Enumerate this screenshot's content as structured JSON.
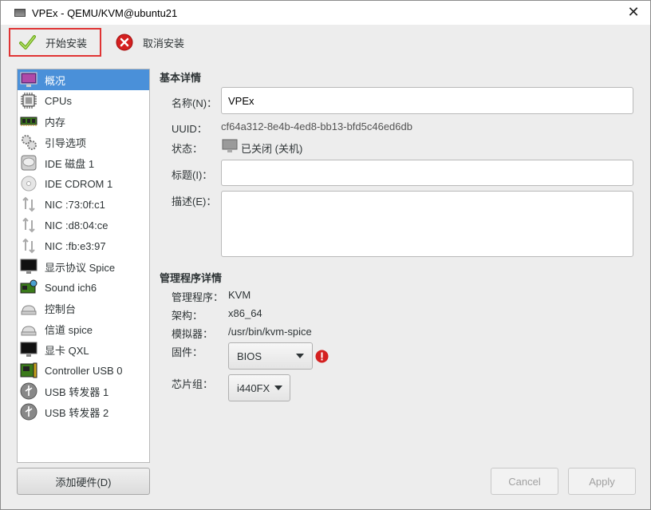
{
  "window": {
    "title": "VPEx - QEMU/KVM@ubuntu21",
    "close_glyph": "✕"
  },
  "toolbar": {
    "start_install": "开始安装",
    "cancel_install": "取消安装"
  },
  "sidebar": {
    "items": [
      {
        "label": "概况",
        "icon": "monitor-overview-icon"
      },
      {
        "label": "CPUs",
        "icon": "cpu-chip-icon"
      },
      {
        "label": "内存",
        "icon": "memory-module-icon"
      },
      {
        "label": "引导选项",
        "icon": "boot-gears-icon"
      },
      {
        "label": "IDE 磁盘 1",
        "icon": "hard-disk-icon"
      },
      {
        "label": "IDE CDROM 1",
        "icon": "cdrom-icon"
      },
      {
        "label": "NIC :73:0f:c1",
        "icon": "network-icon"
      },
      {
        "label": "NIC :d8:04:ce",
        "icon": "network-icon"
      },
      {
        "label": "NIC :fb:e3:97",
        "icon": "network-icon"
      },
      {
        "label": "显示协议 Spice",
        "icon": "display-monitor-icon"
      },
      {
        "label": "Sound ich6",
        "icon": "sound-card-icon"
      },
      {
        "label": "控制台",
        "icon": "serial-console-icon"
      },
      {
        "label": "信道 spice",
        "icon": "channel-icon"
      },
      {
        "label": "显卡 QXL",
        "icon": "video-card-icon"
      },
      {
        "label": "Controller USB 0",
        "icon": "usb-controller-icon"
      },
      {
        "label": "USB 转发器 1",
        "icon": "usb-redirector-icon"
      },
      {
        "label": "USB 转发器 2",
        "icon": "usb-redirector-icon"
      }
    ],
    "add_hardware": "添加硬件(D)"
  },
  "basic": {
    "section_title": "基本详情",
    "name_label": "名称(N)：",
    "name_value": "VPEx",
    "uuid_label": "UUID：",
    "uuid_value": "cf64a312-8e4b-4ed8-bb13-bfd5c46ed6db",
    "status_label": "状态：",
    "status_value": "已关闭 (关机)",
    "title_label": "标题(I)：",
    "title_value": "",
    "desc_label": "描述(E)：",
    "desc_value": ""
  },
  "hypervisor": {
    "section_title": "管理程序详情",
    "hv_label": "管理程序：",
    "hv_value": "KVM",
    "arch_label": "架构：",
    "arch_value": "x86_64",
    "emu_label": "模拟器：",
    "emu_value": "/usr/bin/kvm-spice",
    "firmware_label": "固件：",
    "firmware_value": "BIOS",
    "chipset_label": "芯片组：",
    "chipset_value": "i440FX"
  },
  "buttons": {
    "cancel": "Cancel",
    "apply": "Apply"
  },
  "colors": {
    "selected": "#4a90d9",
    "highlight_border": "#e03434",
    "warning": "#d42020"
  }
}
